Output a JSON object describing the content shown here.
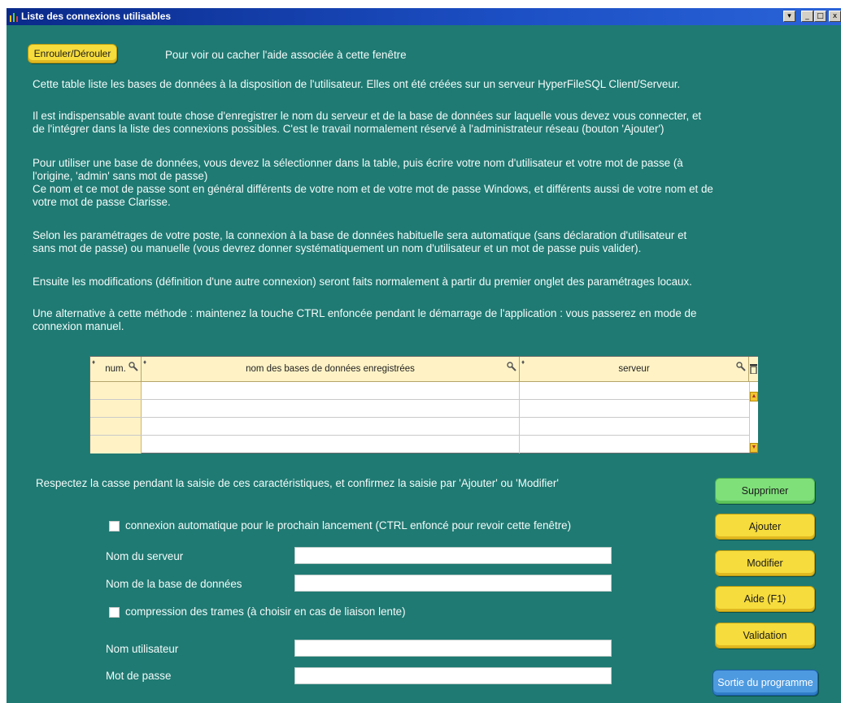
{
  "window": {
    "title": "Liste des connexions utilisables"
  },
  "titlebar_buttons": {
    "menu": "▾",
    "minimize": "_",
    "maximize": "□",
    "close": "x"
  },
  "toggle_help": {
    "button_label": "Enrouler/Dérouler",
    "description": "Pour voir ou cacher l'aide associée à cette fenêtre"
  },
  "help": {
    "p1": "Cette table liste les bases de données à la disposition de l'utilisateur. Elles ont été créées sur un serveur HyperFileSQL Client/Serveur.",
    "p2a": "Il est indispensable avant toute chose d'enregistrer le nom du serveur et de la base de données sur laquelle vous devez vous connecter, et",
    "p2b": "de l'intégrer dans la liste des connexions possibles. C'est le travail normalement réservé à l'administrateur réseau (bouton 'Ajouter')",
    "p3a": "Pour utiliser une base de données, vous devez la sélectionner dans la table, puis écrire votre nom d'utilisateur et votre mot de passe (à",
    "p3b": "l'origine, 'admin' sans mot de passe)",
    "p3c": "Ce nom et ce mot de passe sont en général différents de votre nom et de votre mot de passe Windows, et différents aussi de votre nom et de",
    "p3d": "votre mot de passe Clarisse.",
    "p4a": "Selon les paramétrages de votre poste, la connexion à la base de données habituelle sera automatique (sans déclaration d'utilisateur et",
    "p4b": "sans mot de passe) ou manuelle (vous devrez donner systématiquement un nom d'utilisateur et un mot de passe puis valider).",
    "p5": "Ensuite les modifications (définition d'une autre connexion) seront faits normalement à partir du premier onglet des paramétrages locaux.",
    "p6a": "Une alternative à cette méthode : maintenez la touche CTRL enfoncée pendant le démarrage de l'application : vous passerez en mode de",
    "p6b": "connexion manuel."
  },
  "table": {
    "columns": {
      "num": "num.",
      "name": "nom des bases de données enregistrées",
      "server": "serveur"
    },
    "rows": [
      [
        "",
        "",
        ""
      ],
      [
        "",
        "",
        ""
      ],
      [
        "",
        "",
        ""
      ],
      [
        "",
        "",
        ""
      ]
    ]
  },
  "form": {
    "case_note": "Respectez la casse pendant la saisie de ces caractéristiques, et confirmez la saisie par 'Ajouter' ou 'Modifier'",
    "auto_connect_label": "connexion automatique pour le prochain lancement (CTRL enfoncé pour revoir cette fenêtre)",
    "server_label": "Nom du serveur",
    "server_value": "",
    "database_label": "Nom de la base de données",
    "database_value": "",
    "compression_label": "compression des trames (à choisir en cas de liaison lente)",
    "user_label": "Nom utilisateur",
    "user_value": "",
    "password_label": "Mot de passe",
    "password_value": ""
  },
  "buttons": {
    "delete": "Supprimer",
    "add": "Ajouter",
    "modify": "Modifier",
    "help": "Aide (F1)",
    "validate": "Validation",
    "exit": "Sortie du programme"
  },
  "colors": {
    "window_bg": "#1f7a73",
    "button_yellow": "#f6dc3c",
    "button_green": "#7fe07a",
    "button_blue": "#4e9ae0",
    "header_bg": "#fff3c6"
  },
  "icons": {
    "app": "app-icon",
    "search": "search-icon",
    "trash": "trash-icon",
    "sort": "sort-icon",
    "scroll_up": "scroll-up-icon",
    "scroll_down": "scroll-down-icon"
  }
}
